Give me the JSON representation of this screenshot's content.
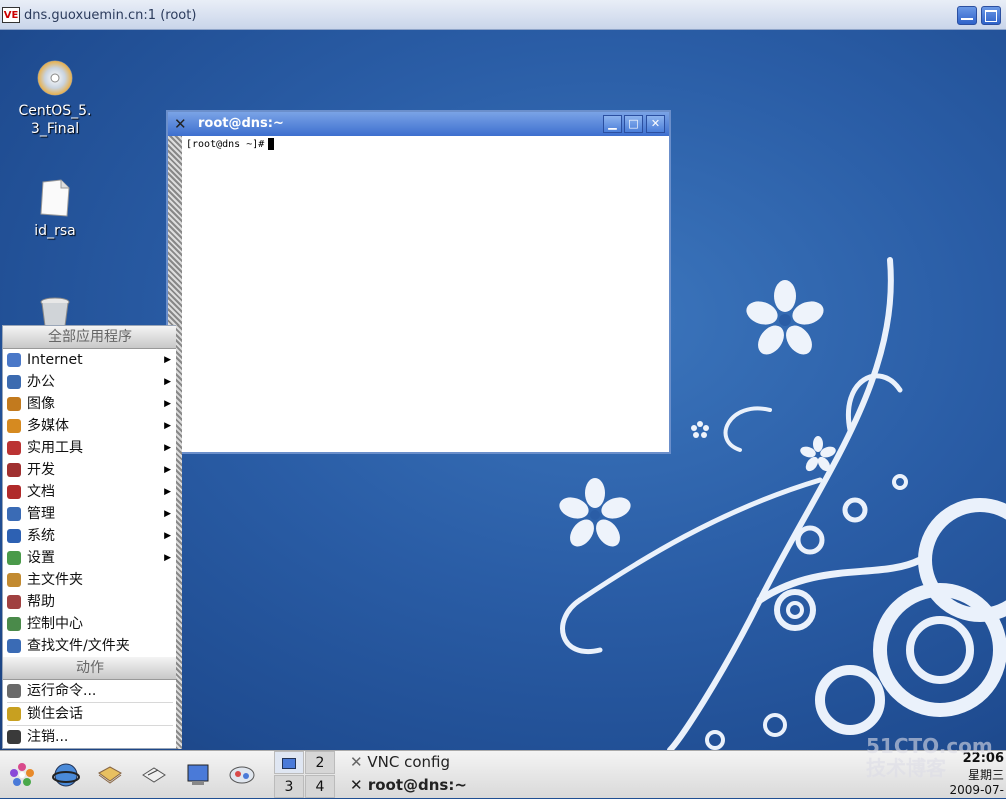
{
  "vnc": {
    "title": "dns.guoxuemin.cn:1 (root)",
    "logo": "VE"
  },
  "desktop": {
    "icons": [
      {
        "label": "CentOS_5.\n3_Final",
        "icon": "disc-icon"
      },
      {
        "label": "id_rsa",
        "icon": "document-icon"
      },
      {
        "label": "",
        "icon": "trash-icon"
      }
    ]
  },
  "terminal": {
    "title": "root@dns:~",
    "prompt": "[root@dns ~]#"
  },
  "menu": {
    "header_apps": "全部应用程序",
    "apps": [
      {
        "label": "Internet",
        "submenu": true,
        "color": "#4a78c8"
      },
      {
        "label": "办公",
        "submenu": true,
        "color": "#3c6bb0"
      },
      {
        "label": "图像",
        "submenu": true,
        "color": "#c27a1e"
      },
      {
        "label": "多媒体",
        "submenu": true,
        "color": "#d68a20"
      },
      {
        "label": "实用工具",
        "submenu": true,
        "color": "#b33"
      },
      {
        "label": "开发",
        "submenu": true,
        "color": "#a03030"
      },
      {
        "label": "文档",
        "submenu": true,
        "color": "#b02a2a"
      },
      {
        "label": "管理",
        "submenu": true,
        "color": "#3a6bb5"
      },
      {
        "label": "系统",
        "submenu": true,
        "color": "#2d61b3"
      },
      {
        "label": "设置",
        "submenu": true,
        "color": "#4a9a4a"
      },
      {
        "label": "主文件夹",
        "submenu": false,
        "color": "#c28a30"
      },
      {
        "label": "帮助",
        "submenu": false,
        "color": "#a04040"
      },
      {
        "label": "控制中心",
        "submenu": false,
        "color": "#4a8a4a"
      },
      {
        "label": "查找文件/文件夹",
        "submenu": false,
        "color": "#3a6bb5"
      }
    ],
    "header_actions": "动作",
    "actions": [
      {
        "label": "运行命令...",
        "color": "#6a6a6a"
      },
      {
        "label": "锁住会话",
        "color": "#c8a020"
      },
      {
        "label": "注销...",
        "color": "#3a3a3a"
      }
    ]
  },
  "taskbar": {
    "pager": [
      "1",
      "2",
      "3",
      "4"
    ],
    "tasks": [
      "VNC config",
      "root@dns:~"
    ],
    "clock_time": "22:06",
    "clock_day": "星期三",
    "clock_date": "2009-07-"
  },
  "watermark": "51CTO.com 技术博客"
}
